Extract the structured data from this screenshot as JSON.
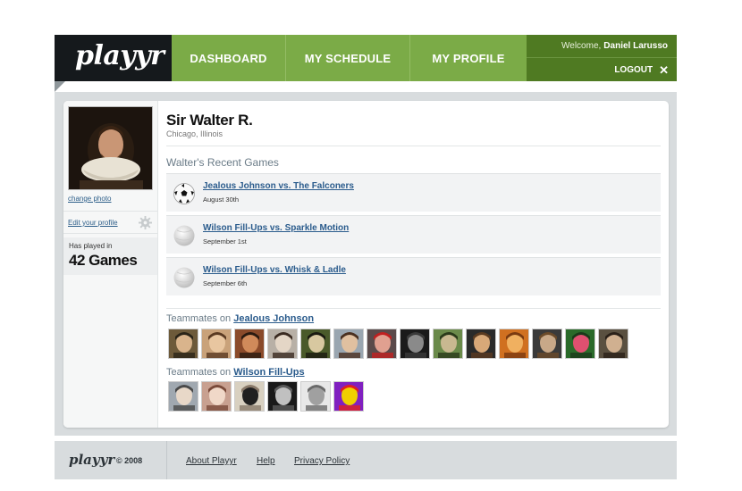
{
  "header": {
    "logo": "playyr",
    "nav": [
      {
        "label": "DASHBOARD"
      },
      {
        "label": "MY SCHEDULE"
      },
      {
        "label": "MY PROFILE"
      }
    ],
    "welcome_prefix": "Welcome,",
    "user_name": "Daniel Larusso",
    "logout_label": "LOGOUT",
    "logout_icon": "close-icon"
  },
  "colors": {
    "nav_green": "#7bab47",
    "user_green": "#4f7a22",
    "logo_dark": "#15191c",
    "link_blue": "#2a5b8c"
  },
  "sidebar": {
    "change_photo": "change photo",
    "edit_profile": "Edit your profile",
    "played_label": "Has played in",
    "played_count": "42 Games"
  },
  "profile": {
    "name": "Sir Walter R.",
    "location": "Chicago, Illinois",
    "recent_title": "Walter's Recent Games",
    "games": [
      {
        "title": "Jealous Johnson vs. The Falconers",
        "date": "August 30th",
        "icon": "soccer-ball-icon"
      },
      {
        "title": "Wilson Fill-Ups vs. Sparkle Motion",
        "date": "September 1st",
        "icon": "volleyball-icon"
      },
      {
        "title": "Wilson Fill-Ups vs. Whisk & Ladle",
        "date": "September 6th",
        "icon": "volleyball-icon"
      }
    ]
  },
  "teams": [
    {
      "prefix": "Teammates on",
      "name": "Jealous Johnson",
      "count": 14
    },
    {
      "prefix": "Teammates on",
      "name": "Wilson Fill-Ups",
      "count": 6
    }
  ],
  "footer": {
    "logo": "playyr",
    "copyright": "© 2008",
    "links": [
      "About Playyr",
      "Help",
      "Privacy Policy"
    ]
  }
}
